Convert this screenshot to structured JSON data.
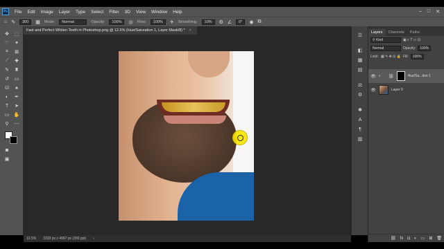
{
  "menubar": {
    "app_logo": "Ps",
    "items": [
      "File",
      "Edit",
      "Image",
      "Layer",
      "Type",
      "Select",
      "Filter",
      "3D",
      "View",
      "Window",
      "Help"
    ],
    "window_controls": [
      "–",
      "□",
      "✕"
    ]
  },
  "options": {
    "brush_size": "300",
    "mode_label": "Mode:",
    "mode_value": "Normal",
    "opacity_label": "Opacity:",
    "opacity_value": "100%",
    "flow_label": "Flow:",
    "flow_value": "100%",
    "smoothing_label": "Smoothing:",
    "smoothing_value": "10%",
    "angle_value": "0°"
  },
  "document": {
    "tab_title": "Fast and Perfect Whiten Teeth in Photoshop.png @ 12.5% (Hue/Saturation 1, Layer Mask/8) *",
    "close": "×"
  },
  "status": {
    "zoom": "12.5%",
    "dimensions": "3333 px x 4967 px (300 ppi)"
  },
  "layers_panel": {
    "tabs": [
      "Layers",
      "Channels",
      "Paths"
    ],
    "filter_label": "Kind",
    "blend_mode": "Normal",
    "opacity_label": "Opacity:",
    "opacity_value": "100%",
    "lock_label": "Lock:",
    "fill_label": "Fill:",
    "fill_value": "100%",
    "layers": [
      {
        "name": "Hue/Sa...tion 1",
        "active": true
      },
      {
        "name": "Layer 0",
        "active": false
      }
    ]
  },
  "colors": {
    "accent_ps": "#31a8ff",
    "cursor": "#ffe600",
    "panel_bg": "#424242",
    "canvas_bg": "#282828"
  }
}
